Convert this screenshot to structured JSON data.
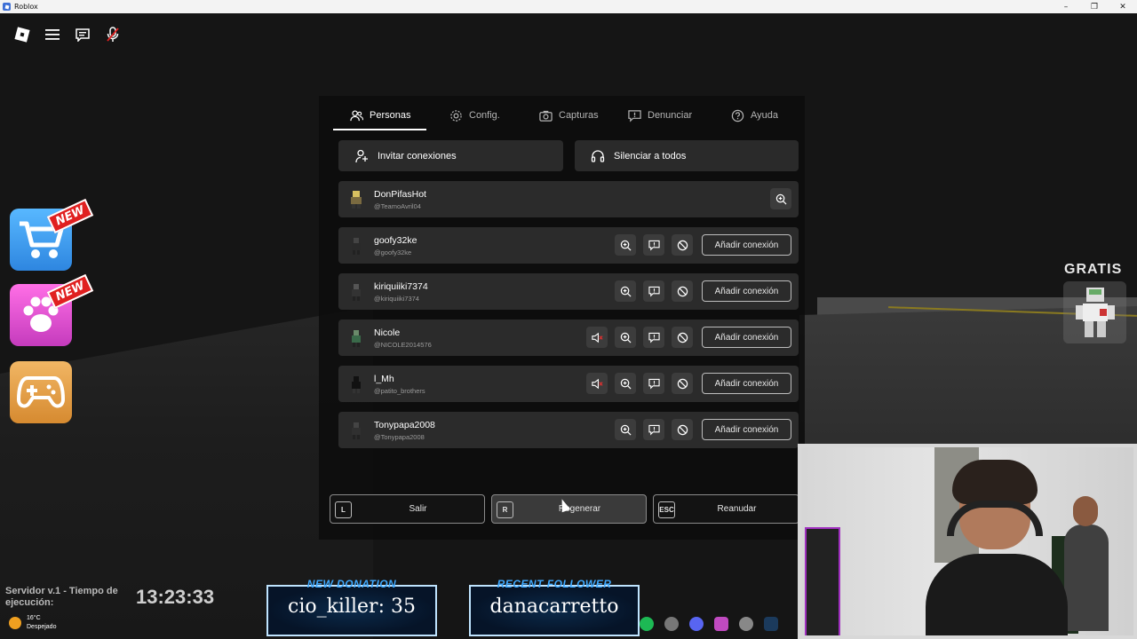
{
  "window": {
    "title": "Roblox",
    "controls": [
      "–",
      "❐",
      "✕"
    ]
  },
  "top_buttons": [
    "roblox-menu-icon",
    "hamburger-icon",
    "chat-icon",
    "microphone-icon"
  ],
  "side_icons": {
    "new_badge": "NEW"
  },
  "gratis": {
    "label": "GRATIS"
  },
  "menu": {
    "tabs": [
      {
        "label": "Personas",
        "icon": "people-icon",
        "active": true
      },
      {
        "label": "Config.",
        "icon": "gear-icon",
        "active": false
      },
      {
        "label": "Capturas",
        "icon": "camera-icon",
        "active": false
      },
      {
        "label": "Denunciar",
        "icon": "report-icon",
        "active": false
      },
      {
        "label": "Ayuda",
        "icon": "help-icon",
        "active": false
      }
    ],
    "invite_label": "Invitar conexiones",
    "mute_all_label": "Silenciar a todos",
    "add_connection_label": "Añadir conexión",
    "players": [
      {
        "display": "DonPifasHot",
        "username": "@TeamoAvril04",
        "muted": false,
        "is_self": true
      },
      {
        "display": "goofy32ke",
        "username": "@goofy32ke",
        "muted": false,
        "is_self": false
      },
      {
        "display": "kiriquiiki7374",
        "username": "@kiriquiiki7374",
        "muted": false,
        "is_self": false
      },
      {
        "display": "Nicole",
        "username": "@NICOLE2014576",
        "muted": true,
        "is_self": false
      },
      {
        "display": "l_Mh",
        "username": "@patito_brothers",
        "muted": true,
        "is_self": false
      },
      {
        "display": "Tonypapa2008",
        "username": "@Tonypapa2008",
        "muted": false,
        "is_self": false
      }
    ],
    "bottom": [
      {
        "key": "L",
        "label": "Salir"
      },
      {
        "key": "R",
        "label": "Regenerar"
      },
      {
        "key": "ESC",
        "label": "Reanudar"
      }
    ]
  },
  "overlay": {
    "server_text": "Servidor v.1 - Tiempo de ejecución:",
    "clock": "13:23:33",
    "weather_temp": "16°C",
    "weather_desc": "Despejado",
    "donation_title": "NEW DONATION",
    "donation_value": "cio_killer: 35",
    "follower_title": "RECENT FOLLOWER",
    "follower_value": "danacarretto"
  },
  "colors": {
    "panel": "#0c0c0c",
    "row": "#2b2b2b",
    "accent_blue": "#3fa9ff"
  }
}
